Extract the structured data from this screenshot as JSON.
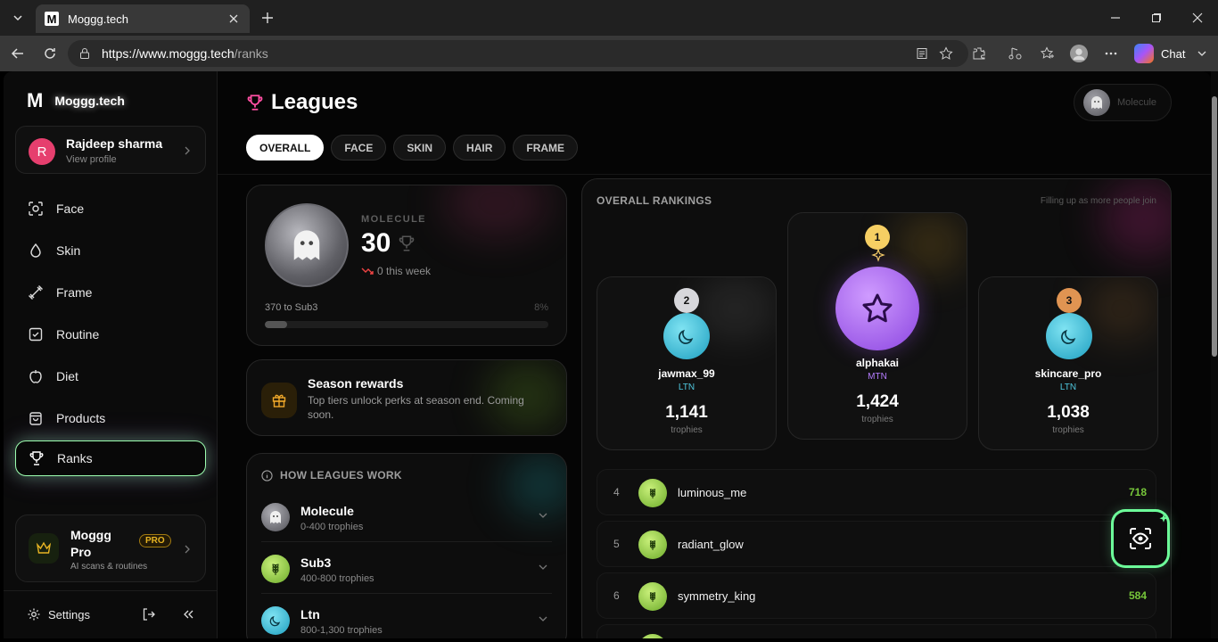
{
  "browser": {
    "tab_title": "Moggg.tech",
    "url_host": "https://www.moggg.tech",
    "url_path": "/ranks",
    "chat_label": "Chat"
  },
  "sidebar": {
    "brand": "Moggg.tech",
    "profile": {
      "initial": "R",
      "name": "Rajdeep sharma",
      "sub": "View profile"
    },
    "items": [
      {
        "label": "Face"
      },
      {
        "label": "Skin"
      },
      {
        "label": "Frame"
      },
      {
        "label": "Routine"
      },
      {
        "label": "Diet"
      },
      {
        "label": "Products"
      },
      {
        "label": "Ranks"
      }
    ],
    "pro": {
      "title": "Moggg Pro",
      "badge": "PRO",
      "sub": "AI scans & routines"
    },
    "settings": "Settings"
  },
  "header": {
    "title": "Leagues",
    "league_pill": "Molecule",
    "tabs": [
      "OVERALL",
      "FACE",
      "SKIN",
      "HAIR",
      "FRAME"
    ]
  },
  "rank_card": {
    "tier": "MOLECULE",
    "score": "30",
    "week": "0 this week",
    "progress_label": "370 to Sub3",
    "progress_pct": "8%",
    "progress_value": 0.08
  },
  "season": {
    "title": "Season rewards",
    "sub": "Top tiers unlock perks at season end. Coming soon."
  },
  "how": {
    "title": "HOW LEAGUES WORK",
    "rows": [
      {
        "name": "Molecule",
        "range": "0-400 trophies"
      },
      {
        "name": "Sub3",
        "range": "400-800 trophies"
      },
      {
        "name": "Ltn",
        "range": "800-1,300 trophies"
      }
    ]
  },
  "rankings": {
    "title": "OVERALL RANKINGS",
    "sub": "Filling up as more people join",
    "trophies_label": "trophies",
    "podium": [
      {
        "rank": "2",
        "name": "jawmax_99",
        "tag": "LTN",
        "score": "1,141"
      },
      {
        "rank": "1",
        "name": "alphakai",
        "tag": "MTN",
        "score": "1,424"
      },
      {
        "rank": "3",
        "name": "skincare_pro",
        "tag": "LTN",
        "score": "1,038"
      }
    ],
    "list": [
      {
        "rank": "4",
        "name": "luminous_me",
        "score": "718"
      },
      {
        "rank": "5",
        "name": "radiant_glow",
        "score": ""
      },
      {
        "rank": "6",
        "name": "symmetry_king",
        "score": "584"
      }
    ]
  },
  "colors": {
    "gold": "#f6cf63",
    "silver": "#d7d7db",
    "bronze": "#e09452",
    "accent_green": "#76c63a",
    "accent_pink": "#ff4fa3"
  }
}
